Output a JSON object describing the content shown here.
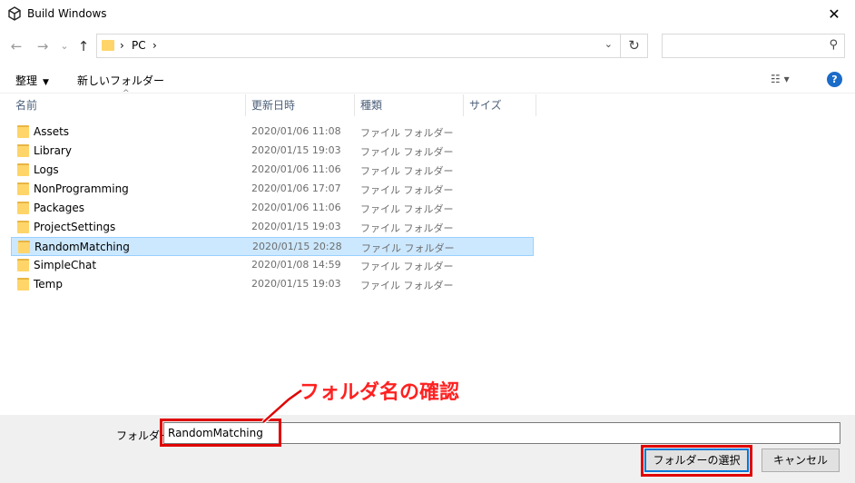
{
  "window": {
    "title": "Build Windows",
    "close_glyph": "✕"
  },
  "nav": {
    "back_glyph": "←",
    "forward_glyph": "→",
    "recent_glyph": "⌄",
    "up_glyph": "↑",
    "breadcrumb_sep_1": "›",
    "breadcrumb_pc": "PC",
    "breadcrumb_sep_2": "›",
    "address_dropdown_glyph": "⌄",
    "refresh_glyph": "↻",
    "search_placeholder": "",
    "search_glyph": "⚲"
  },
  "toolbar": {
    "organize_label": "整理",
    "organize_caret": "▼",
    "new_folder_label": "新しいフォルダー",
    "view_glyph": "☷ ▾",
    "help_glyph": "?"
  },
  "columns": {
    "name": "名前",
    "date": "更新日時",
    "type": "種類",
    "size": "サイズ",
    "sort_glyph": "^"
  },
  "files": [
    {
      "name": "Assets",
      "date": "2020/01/06 11:08",
      "type": "ファイル フォルダー",
      "selected": false
    },
    {
      "name": "Library",
      "date": "2020/01/15 19:03",
      "type": "ファイル フォルダー",
      "selected": false
    },
    {
      "name": "Logs",
      "date": "2020/01/06 11:06",
      "type": "ファイル フォルダー",
      "selected": false
    },
    {
      "name": "NonProgramming",
      "date": "2020/01/06 17:07",
      "type": "ファイル フォルダー",
      "selected": false
    },
    {
      "name": "Packages",
      "date": "2020/01/06 11:06",
      "type": "ファイル フォルダー",
      "selected": false
    },
    {
      "name": "ProjectSettings",
      "date": "2020/01/15 19:03",
      "type": "ファイル フォルダー",
      "selected": false
    },
    {
      "name": "RandomMatching",
      "date": "2020/01/15 20:28",
      "type": "ファイル フォルダー",
      "selected": true
    },
    {
      "name": "SimpleChat",
      "date": "2020/01/08 14:59",
      "type": "ファイル フォルダー",
      "selected": false
    },
    {
      "name": "Temp",
      "date": "2020/01/15 19:03",
      "type": "ファイル フォルダー",
      "selected": false
    }
  ],
  "footer": {
    "folder_label": "フォルダー:",
    "folder_value": "RandomMatching",
    "select_button": "フォルダーの選択",
    "cancel_button": "キャンセル"
  },
  "annotation": {
    "text": "フォルダ名の確認",
    "color": "#e00000"
  }
}
